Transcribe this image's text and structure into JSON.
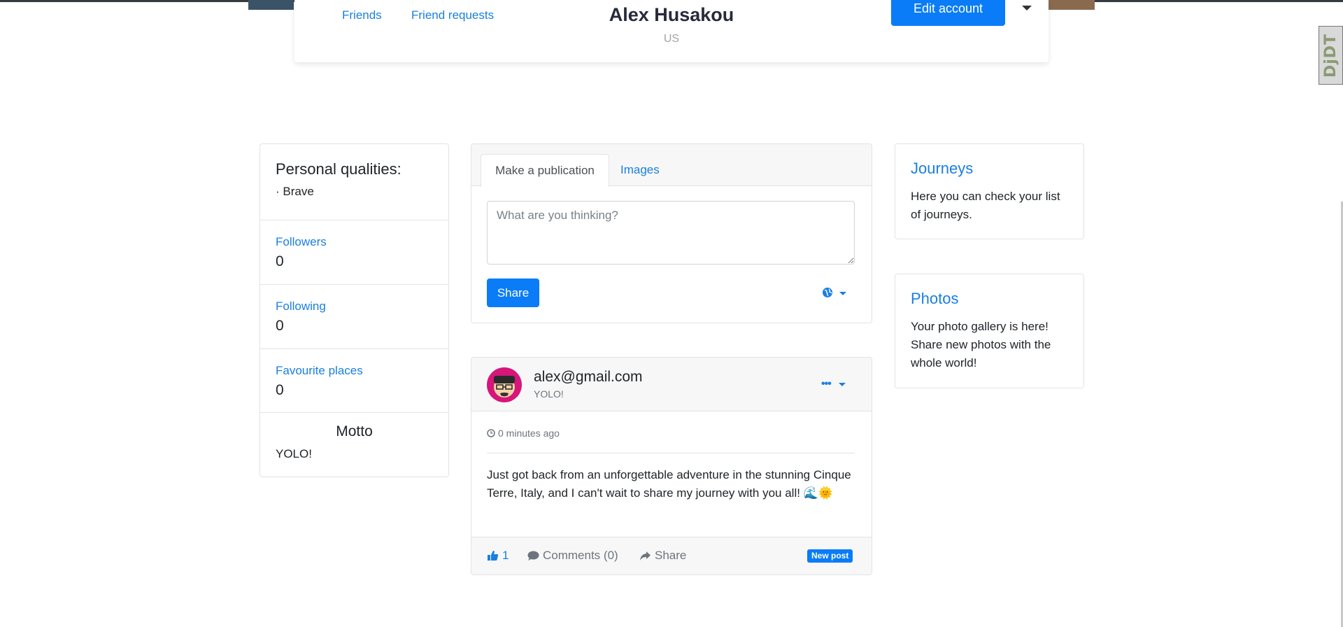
{
  "profile": {
    "name": "Alex Husakou",
    "country": "US",
    "nav": {
      "friends": "Friends",
      "friend_requests": "Friend requests"
    },
    "edit_label": "Edit account"
  },
  "devtools": {
    "label": "DjDT"
  },
  "left_panel": {
    "qualities_title": "Personal qualities:",
    "qualities": [
      "· Brave"
    ],
    "followers": {
      "label": "Followers",
      "count": "0"
    },
    "following": {
      "label": "Following",
      "count": "0"
    },
    "favourite_places": {
      "label": "Favourite places",
      "count": "0"
    },
    "motto": {
      "title": "Motto",
      "text": "YOLO!"
    }
  },
  "publish": {
    "tabs": [
      "Make a publication",
      "Images"
    ],
    "placeholder": "What are you thinking?",
    "share_label": "Share",
    "visibility_icon": "globe-icon"
  },
  "post": {
    "author": "alex@gmail.com",
    "subtitle": "YOLO!",
    "time": "0 minutes ago",
    "text": "Just got back from an unforgettable adventure in the stunning Cinque Terre, Italy, and I can't wait to share my journey with you all! 🌊🌞",
    "likes": "1",
    "comments_label": "Comments (0)",
    "share_label": "Share",
    "badge": "New post"
  },
  "right_panel": {
    "journeys": {
      "title": "Journeys",
      "text": "Here you can check your list of journeys."
    },
    "photos": {
      "title": "Photos",
      "text": "Your photo gallery is here! Share new photos with the whole world!"
    }
  },
  "colors": {
    "accent": "#0a7cf7",
    "link": "#1a7fe0",
    "muted": "#6c757d",
    "border": "#e1e3e6"
  }
}
